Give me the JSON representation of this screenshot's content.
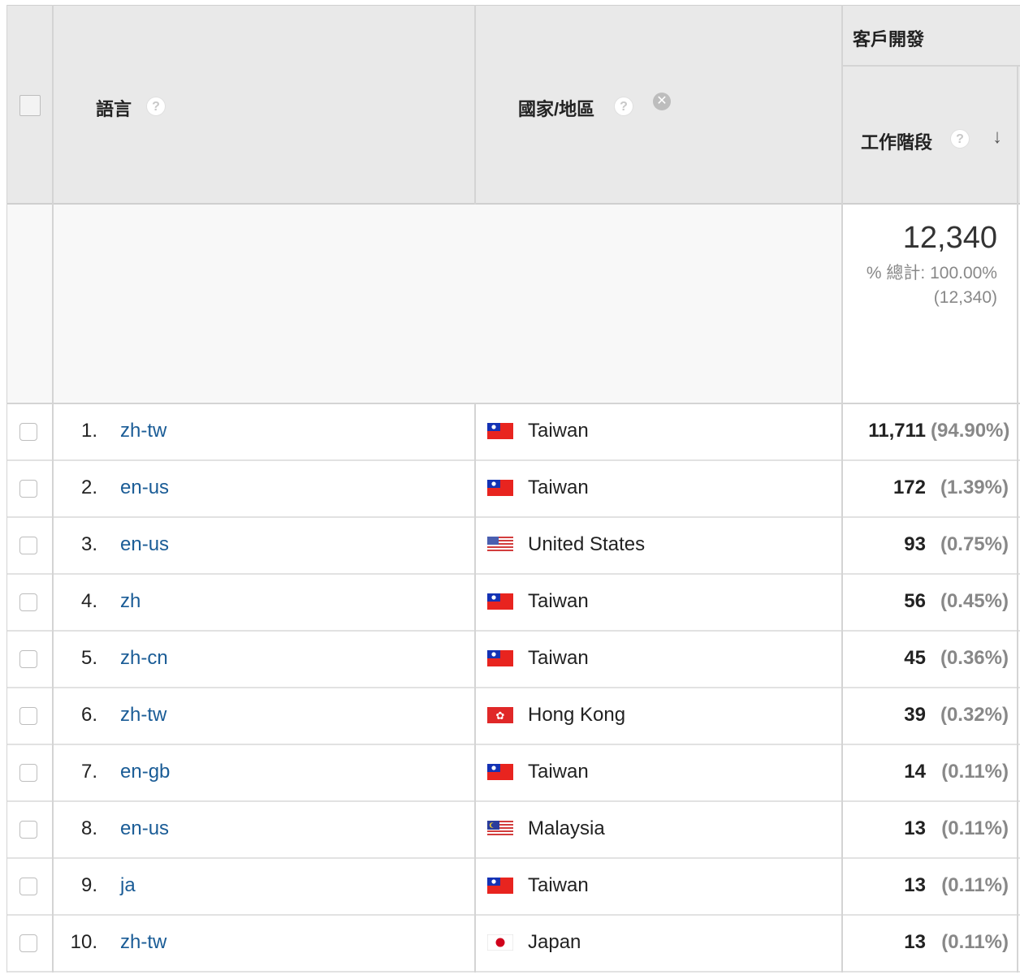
{
  "header": {
    "col_language": "語言",
    "col_country": "國家/地區",
    "group_title": "客戶開發",
    "col_sessions": "工作階段",
    "help_glyph": "?",
    "remove_glyph": "✕",
    "sort_glyph": "↓"
  },
  "totals": {
    "value": "12,340",
    "pct_label": "% 總計: 100.00%",
    "pct_total": "(12,340)"
  },
  "rows": [
    {
      "rank": "1.",
      "language": "zh-tw",
      "country": "Taiwan",
      "flag": "tw",
      "sessions": "11,711",
      "pct": "(94.90%)"
    },
    {
      "rank": "2.",
      "language": "en-us",
      "country": "Taiwan",
      "flag": "tw",
      "sessions": "172",
      "pct": "(1.39%)"
    },
    {
      "rank": "3.",
      "language": "en-us",
      "country": "United States",
      "flag": "us",
      "sessions": "93",
      "pct": "(0.75%)"
    },
    {
      "rank": "4.",
      "language": "zh",
      "country": "Taiwan",
      "flag": "tw",
      "sessions": "56",
      "pct": "(0.45%)"
    },
    {
      "rank": "5.",
      "language": "zh-cn",
      "country": "Taiwan",
      "flag": "tw",
      "sessions": "45",
      "pct": "(0.36%)"
    },
    {
      "rank": "6.",
      "language": "zh-tw",
      "country": "Hong Kong",
      "flag": "hk",
      "sessions": "39",
      "pct": "(0.32%)"
    },
    {
      "rank": "7.",
      "language": "en-gb",
      "country": "Taiwan",
      "flag": "tw",
      "sessions": "14",
      "pct": "(0.11%)"
    },
    {
      "rank": "8.",
      "language": "en-us",
      "country": "Malaysia",
      "flag": "my",
      "sessions": "13",
      "pct": "(0.11%)"
    },
    {
      "rank": "9.",
      "language": "ja",
      "country": "Taiwan",
      "flag": "tw",
      "sessions": "13",
      "pct": "(0.11%)"
    },
    {
      "rank": "10.",
      "language": "zh-tw",
      "country": "Japan",
      "flag": "jp",
      "sessions": "13",
      "pct": "(0.11%)"
    }
  ],
  "colors": {
    "link": "#1a5c96",
    "header_bg": "#e9e9e9",
    "muted": "#888888"
  }
}
